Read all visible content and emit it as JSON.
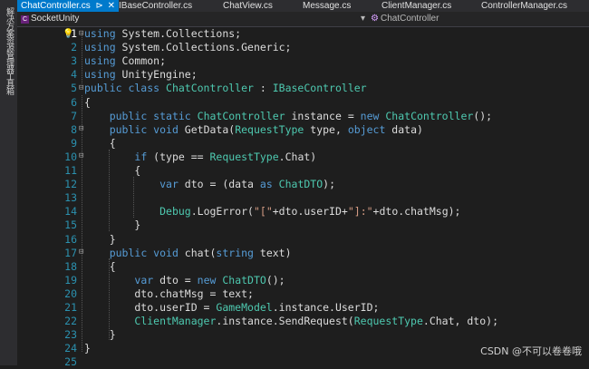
{
  "tabs": [
    {
      "label": "ChatController.cs",
      "active": true
    },
    {
      "label": "IBaseController.cs"
    },
    {
      "label": "ChatView.cs"
    },
    {
      "label": "Message.cs"
    },
    {
      "label": "ClientManager.cs"
    },
    {
      "label": "ControllerManager.cs"
    }
  ],
  "sidebar": {
    "solution_explorer_label": "解决方案资源管理器",
    "toolbox_label": "工具箱"
  },
  "nav": {
    "project": "SocketUnity",
    "member": "ChatController",
    "project_icon": "csharp-project-icon",
    "member_icon": "class-icon"
  },
  "line_numbers": [
    "1",
    "2",
    "3",
    "4",
    "5",
    "6",
    "7",
    "8",
    "9",
    "10",
    "11",
    "12",
    "13",
    "14",
    "15",
    "16",
    "17",
    "18",
    "19",
    "20",
    "21",
    "22",
    "23",
    "24",
    "25"
  ],
  "code_lines": [
    [
      {
        "t": "kw",
        "v": "using"
      },
      {
        "t": "",
        "v": " System.Collections;"
      }
    ],
    [
      {
        "t": "kw",
        "v": "using"
      },
      {
        "t": "",
        "v": " System.Collections.Generic;"
      }
    ],
    [
      {
        "t": "kw",
        "v": "using"
      },
      {
        "t": "",
        "v": " Common;"
      }
    ],
    [
      {
        "t": "kw",
        "v": "using"
      },
      {
        "t": "",
        "v": " UnityEngine;"
      }
    ],
    [
      {
        "t": "kw",
        "v": "public class "
      },
      {
        "t": "ty",
        "v": "ChatController"
      },
      {
        "t": "",
        "v": " : "
      },
      {
        "t": "ty",
        "v": "IBaseController"
      }
    ],
    [
      {
        "t": "",
        "v": "{"
      }
    ],
    [
      {
        "t": "",
        "v": "    "
      },
      {
        "t": "kw",
        "v": "public static "
      },
      {
        "t": "ty",
        "v": "ChatController"
      },
      {
        "t": "",
        "v": " instance = "
      },
      {
        "t": "kw",
        "v": "new "
      },
      {
        "t": "ty",
        "v": "ChatController"
      },
      {
        "t": "",
        "v": "();"
      }
    ],
    [
      {
        "t": "",
        "v": "    "
      },
      {
        "t": "kw",
        "v": "public void "
      },
      {
        "t": "",
        "v": "GetData("
      },
      {
        "t": "ty",
        "v": "RequestType"
      },
      {
        "t": "",
        "v": " type, "
      },
      {
        "t": "kw",
        "v": "object"
      },
      {
        "t": "",
        "v": " data)"
      }
    ],
    [
      {
        "t": "",
        "v": "    {"
      }
    ],
    [
      {
        "t": "",
        "v": "        "
      },
      {
        "t": "kw",
        "v": "if"
      },
      {
        "t": "",
        "v": " (type == "
      },
      {
        "t": "ty",
        "v": "RequestType"
      },
      {
        "t": "",
        "v": ".Chat)"
      }
    ],
    [
      {
        "t": "",
        "v": "        {"
      }
    ],
    [
      {
        "t": "",
        "v": "            "
      },
      {
        "t": "kw",
        "v": "var"
      },
      {
        "t": "",
        "v": " dto = (data "
      },
      {
        "t": "kw",
        "v": "as "
      },
      {
        "t": "ty",
        "v": "ChatDTO"
      },
      {
        "t": "",
        "v": ");"
      }
    ],
    [
      {
        "t": "",
        "v": ""
      }
    ],
    [
      {
        "t": "",
        "v": "            "
      },
      {
        "t": "ty",
        "v": "Debug"
      },
      {
        "t": "",
        "v": ".LogError("
      },
      {
        "t": "st",
        "v": "\"[\""
      },
      {
        "t": "",
        "v": "+dto.userID+"
      },
      {
        "t": "st",
        "v": "\"]:\""
      },
      {
        "t": "",
        "v": "+dto.chatMsg);"
      }
    ],
    [
      {
        "t": "",
        "v": "        }"
      }
    ],
    [
      {
        "t": "",
        "v": "    }"
      }
    ],
    [
      {
        "t": "",
        "v": "    "
      },
      {
        "t": "kw",
        "v": "public void "
      },
      {
        "t": "",
        "v": "chat("
      },
      {
        "t": "kw",
        "v": "string"
      },
      {
        "t": "",
        "v": " text)"
      }
    ],
    [
      {
        "t": "",
        "v": "    {"
      }
    ],
    [
      {
        "t": "",
        "v": "        "
      },
      {
        "t": "kw",
        "v": "var"
      },
      {
        "t": "",
        "v": " dto = "
      },
      {
        "t": "kw",
        "v": "new "
      },
      {
        "t": "ty",
        "v": "ChatDTO"
      },
      {
        "t": "",
        "v": "();"
      }
    ],
    [
      {
        "t": "",
        "v": "        dto.chatMsg = text;"
      }
    ],
    [
      {
        "t": "",
        "v": "        dto.userID = "
      },
      {
        "t": "ty",
        "v": "GameModel"
      },
      {
        "t": "",
        "v": ".instance.UserID;"
      }
    ],
    [
      {
        "t": "",
        "v": "        "
      },
      {
        "t": "ty",
        "v": "ClientManager"
      },
      {
        "t": "",
        "v": ".instance.SendRequest("
      },
      {
        "t": "ty",
        "v": "RequestType"
      },
      {
        "t": "",
        "v": ".Chat, dto);"
      }
    ],
    [
      {
        "t": "",
        "v": "    }"
      }
    ],
    [
      {
        "t": "",
        "v": "}"
      }
    ],
    [
      {
        "t": "",
        "v": ""
      }
    ]
  ],
  "watermark": "CSDN @不可以卷卷哦",
  "colors": {
    "keyword": "#569cd6",
    "type": "#4ec9b0",
    "string": "#d69d85",
    "text": "#dcdcdc",
    "line_number": "#2b91af",
    "active_tab": "#007acc"
  }
}
